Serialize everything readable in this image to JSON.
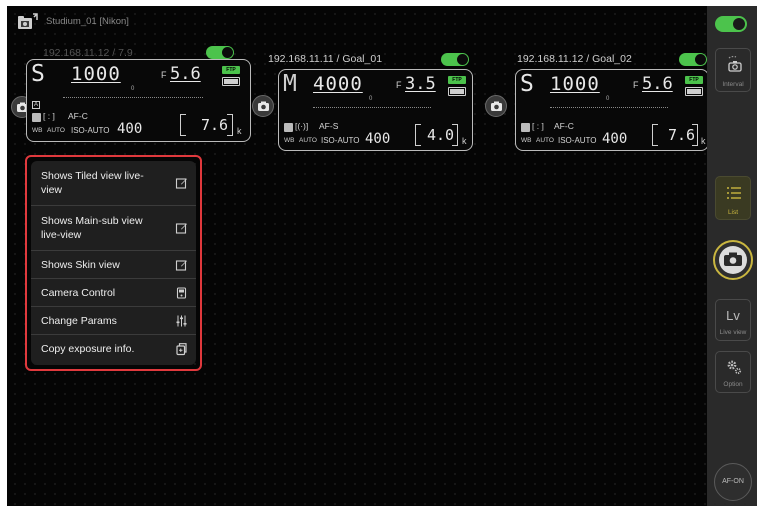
{
  "header": {
    "studio_title": "Studium_01 [Nikon]"
  },
  "cameras": [
    {
      "ip": "192.168.11.12 / 7.9",
      "enabled": true,
      "mode": "S",
      "shutter": "1000",
      "fprefix": "F",
      "aperture": "5.6",
      "ftp_badge": "FTP",
      "exposure_zero": "0",
      "a_badge": "A",
      "af_bracket": "[ : ]",
      "af_mode": "AF-C",
      "wb_label": "WB",
      "wb_value": "AUTO",
      "iso_label": "ISO-AUTO",
      "iso_value": "400",
      "shots": "7.6",
      "shots_unit": "k"
    },
    {
      "ip": "192.168.11.11 / Goal_01",
      "enabled": true,
      "mode": "M",
      "shutter": "4000",
      "fprefix": "F",
      "aperture": "3.5",
      "ftp_badge": "FTP",
      "exposure_zero": "0",
      "af_bracket": "[(·)]",
      "af_mode": "AF-S",
      "wb_label": "WB",
      "wb_value": "AUTO",
      "iso_label": "ISO-AUTO",
      "iso_value": "400",
      "shots": "4.0",
      "shots_unit": "k"
    },
    {
      "ip": "192.168.11.12 / Goal_02",
      "enabled": true,
      "mode": "S",
      "shutter": "1000",
      "fprefix": "F",
      "aperture": "5.6",
      "ftp_badge": "FTP",
      "exposure_zero": "0",
      "af_bracket": "[ : ]",
      "af_mode": "AF-C",
      "wb_label": "WB",
      "wb_value": "AUTO",
      "iso_label": "ISO-AUTO",
      "iso_value": "400",
      "shots": "7.6",
      "shots_unit": "k"
    }
  ],
  "menu": {
    "items": [
      {
        "label": "Shows Tiled view live-view",
        "icon": "edit-icon"
      },
      {
        "label": "Shows Main-sub view live-view",
        "icon": "edit-icon"
      },
      {
        "label": "Shows Skin view",
        "icon": "edit-icon"
      },
      {
        "label": "Camera Control",
        "icon": "camera-control-icon"
      },
      {
        "label": "Change Params",
        "icon": "sliders-icon"
      },
      {
        "label": "Copy exposure info.",
        "icon": "copy-icon"
      }
    ]
  },
  "sidebar": {
    "master_toggle_on": true,
    "interval_label": "Interval",
    "list_label": "List",
    "live_view_icon": "Lv",
    "live_view_label": "Live view",
    "option_label": "Option",
    "afon_label": "AF-ON"
  },
  "colors": {
    "accent_green": "#4cc34c",
    "highlight_red": "#e0393d",
    "active_yellow": "#c9b640"
  }
}
